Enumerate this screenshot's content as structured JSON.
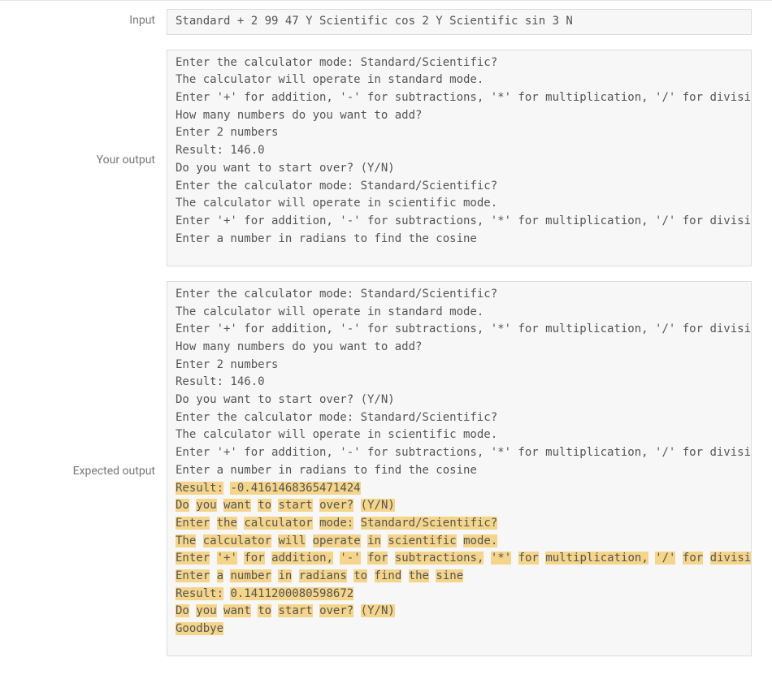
{
  "labels": {
    "input": "Input",
    "your_output": "Your output",
    "expected_output": "Expected output"
  },
  "input_value": "Standard + 2 99 47 Y Scientific cos 2 Y Scientific sin 3 N",
  "your_output_lines": [
    "Enter the calculator mode: Standard/Scientific?",
    "The calculator will operate in standard mode.",
    "Enter '+' for addition, '-' for subtractions, '*' for multiplication, '/' for division",
    "How many numbers do you want to add?",
    "Enter 2 numbers",
    "Result: 146.0",
    "Do you want to start over? (Y/N)",
    "Enter the calculator mode: Standard/Scientific?",
    "The calculator will operate in scientific mode.",
    "Enter '+' for addition, '-' for subtractions, '*' for multiplication, '/' for division",
    "Enter a number in radians to find the cosine"
  ],
  "expected_output_lines": [
    {
      "segments": [
        {
          "t": "Enter the calculator mode: Standard/Scientific?",
          "h": false
        }
      ]
    },
    {
      "segments": [
        {
          "t": "The calculator will operate in standard mode.",
          "h": false
        }
      ]
    },
    {
      "segments": [
        {
          "t": "Enter '+' for addition, '-' for subtractions, '*' for multiplication, '/' for division",
          "h": false
        }
      ]
    },
    {
      "segments": [
        {
          "t": "How many numbers do you want to add?",
          "h": false
        }
      ]
    },
    {
      "segments": [
        {
          "t": "Enter 2 numbers",
          "h": false
        }
      ]
    },
    {
      "segments": [
        {
          "t": "Result: 146.0",
          "h": false
        }
      ]
    },
    {
      "segments": [
        {
          "t": "Do you want to start over? (Y/N)",
          "h": false
        }
      ]
    },
    {
      "segments": [
        {
          "t": "Enter the calculator mode: Standard/Scientific?",
          "h": false
        }
      ]
    },
    {
      "segments": [
        {
          "t": "The calculator will operate in scientific mode.",
          "h": false
        }
      ]
    },
    {
      "segments": [
        {
          "t": "Enter '+' for addition, '-' for subtractions, '*' for multiplication, '/' for division",
          "h": false
        }
      ]
    },
    {
      "segments": [
        {
          "t": "Enter a number in radians to find the cosine",
          "h": false
        }
      ]
    },
    {
      "segments": [
        {
          "t": "Result:",
          "h": true
        },
        {
          "t": " ",
          "h": false
        },
        {
          "t": "-0.4161468365471424",
          "h": true
        }
      ]
    },
    {
      "segments": [
        {
          "t": "Do",
          "h": true
        },
        {
          "t": " ",
          "h": false
        },
        {
          "t": "you",
          "h": true
        },
        {
          "t": " ",
          "h": false
        },
        {
          "t": "want",
          "h": true
        },
        {
          "t": " ",
          "h": false
        },
        {
          "t": "to",
          "h": true
        },
        {
          "t": " ",
          "h": false
        },
        {
          "t": "start",
          "h": true
        },
        {
          "t": " ",
          "h": false
        },
        {
          "t": "over?",
          "h": true
        },
        {
          "t": " ",
          "h": false
        },
        {
          "t": "(Y/N)",
          "h": true
        }
      ]
    },
    {
      "segments": [
        {
          "t": "Enter",
          "h": true
        },
        {
          "t": " ",
          "h": false
        },
        {
          "t": "the",
          "h": true
        },
        {
          "t": " ",
          "h": false
        },
        {
          "t": "calculator",
          "h": true
        },
        {
          "t": " ",
          "h": false
        },
        {
          "t": "mode:",
          "h": true
        },
        {
          "t": " ",
          "h": false
        },
        {
          "t": "Standard/Scientific?",
          "h": true
        }
      ]
    },
    {
      "segments": [
        {
          "t": "The",
          "h": true
        },
        {
          "t": " ",
          "h": false
        },
        {
          "t": "calculator",
          "h": true
        },
        {
          "t": " ",
          "h": false
        },
        {
          "t": "will",
          "h": true
        },
        {
          "t": " ",
          "h": false
        },
        {
          "t": "operate",
          "h": true
        },
        {
          "t": " ",
          "h": false
        },
        {
          "t": "in",
          "h": true
        },
        {
          "t": " ",
          "h": false
        },
        {
          "t": "scientific",
          "h": true
        },
        {
          "t": " ",
          "h": false
        },
        {
          "t": "mode.",
          "h": true
        }
      ]
    },
    {
      "segments": [
        {
          "t": "Enter",
          "h": true
        },
        {
          "t": " ",
          "h": false
        },
        {
          "t": "'+'",
          "h": true
        },
        {
          "t": " ",
          "h": false
        },
        {
          "t": "for",
          "h": true
        },
        {
          "t": " ",
          "h": false
        },
        {
          "t": "addition,",
          "h": true
        },
        {
          "t": " ",
          "h": false
        },
        {
          "t": "'-'",
          "h": true
        },
        {
          "t": " ",
          "h": false
        },
        {
          "t": "for",
          "h": true
        },
        {
          "t": " ",
          "h": false
        },
        {
          "t": "subtractions,",
          "h": true
        },
        {
          "t": " ",
          "h": false
        },
        {
          "t": "'*'",
          "h": true
        },
        {
          "t": " ",
          "h": false
        },
        {
          "t": "for",
          "h": true
        },
        {
          "t": " ",
          "h": false
        },
        {
          "t": "multiplication,",
          "h": true
        },
        {
          "t": " ",
          "h": false
        },
        {
          "t": "'/'",
          "h": true
        },
        {
          "t": " ",
          "h": false
        },
        {
          "t": "for",
          "h": true
        },
        {
          "t": " ",
          "h": false
        },
        {
          "t": "division",
          "h": true
        }
      ]
    },
    {
      "segments": [
        {
          "t": "Enter",
          "h": true
        },
        {
          "t": " ",
          "h": false
        },
        {
          "t": "a",
          "h": true
        },
        {
          "t": " ",
          "h": false
        },
        {
          "t": "number",
          "h": true
        },
        {
          "t": " ",
          "h": false
        },
        {
          "t": "in",
          "h": true
        },
        {
          "t": " ",
          "h": false
        },
        {
          "t": "radians",
          "h": true
        },
        {
          "t": " ",
          "h": false
        },
        {
          "t": "to",
          "h": true
        },
        {
          "t": " ",
          "h": false
        },
        {
          "t": "find",
          "h": true
        },
        {
          "t": " ",
          "h": false
        },
        {
          "t": "the",
          "h": true
        },
        {
          "t": " ",
          "h": false
        },
        {
          "t": "sine",
          "h": true
        }
      ]
    },
    {
      "segments": [
        {
          "t": "Result:",
          "h": true
        },
        {
          "t": " ",
          "h": false
        },
        {
          "t": "0.1411200080598672",
          "h": true
        }
      ]
    },
    {
      "segments": [
        {
          "t": "Do",
          "h": true
        },
        {
          "t": " ",
          "h": false
        },
        {
          "t": "you",
          "h": true
        },
        {
          "t": " ",
          "h": false
        },
        {
          "t": "want",
          "h": true
        },
        {
          "t": " ",
          "h": false
        },
        {
          "t": "to",
          "h": true
        },
        {
          "t": " ",
          "h": false
        },
        {
          "t": "start",
          "h": true
        },
        {
          "t": " ",
          "h": false
        },
        {
          "t": "over?",
          "h": true
        },
        {
          "t": " ",
          "h": false
        },
        {
          "t": "(Y/N)",
          "h": true
        }
      ]
    },
    {
      "segments": [
        {
          "t": "Goodbye",
          "h": true
        }
      ]
    }
  ]
}
